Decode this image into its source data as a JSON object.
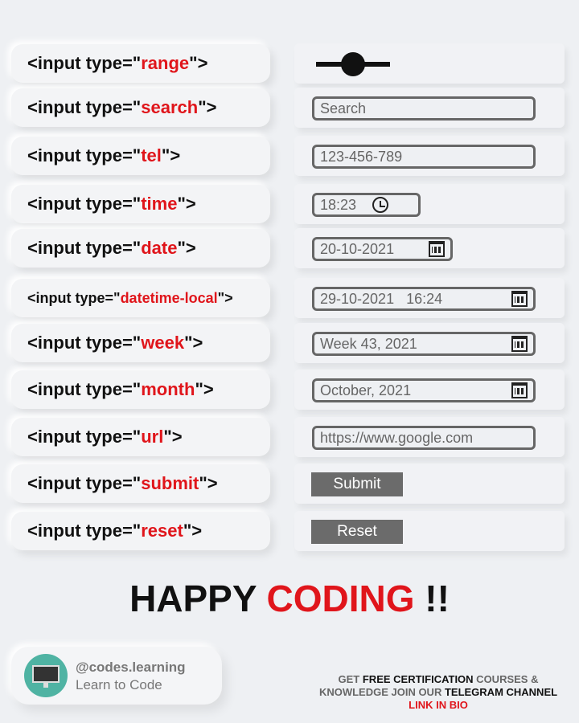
{
  "rows": [
    {
      "prefix": "<input type=\"",
      "type": "range",
      "suffix": "\">"
    },
    {
      "prefix": "<input type=\"",
      "type": "search",
      "suffix": "\">",
      "placeholder": "Search"
    },
    {
      "prefix": "<input type=\"",
      "type": "tel",
      "suffix": "\">",
      "value": "123-456-789"
    },
    {
      "prefix": "<input type=\"",
      "type": "time",
      "suffix": "\">",
      "value": "18:23"
    },
    {
      "prefix": "<input type=\"",
      "type": "date",
      "suffix": "\">",
      "value": "20-10-2021"
    },
    {
      "prefix": "<input type=\"",
      "type": "datetime-local",
      "suffix": "\">",
      "value": "29-10-2021   16:24"
    },
    {
      "prefix": "<input type=\"",
      "type": "week",
      "suffix": "\">",
      "value": "Week 43, 2021"
    },
    {
      "prefix": "<input type=\"",
      "type": "month",
      "suffix": "\">",
      "value": "October, 2021"
    },
    {
      "prefix": "<input type=\"",
      "type": "url",
      "suffix": "\">",
      "value": "https://www.google.com"
    },
    {
      "prefix": "<input type=\"",
      "type": "submit",
      "suffix": "\">",
      "value": "Submit"
    },
    {
      "prefix": "<input type=\"",
      "type": "reset",
      "suffix": "\">",
      "value": "Reset"
    }
  ],
  "range_value": 0.5,
  "headline": {
    "part1": "HAPPY ",
    "part2": "CODING",
    "part3": " !!"
  },
  "profile": {
    "handle": "@codes.learning",
    "tagline": "Learn to Code"
  },
  "promo": {
    "a": "GET ",
    "b": "FREE CERTIFICATION",
    "c": " COURSES &",
    "d": "KNOWLEDGE JOIN OUR ",
    "e": "TELEGRAM CHANNEL",
    "f": "LINK IN BIO"
  },
  "colors": {
    "accent": "#e0151b"
  }
}
